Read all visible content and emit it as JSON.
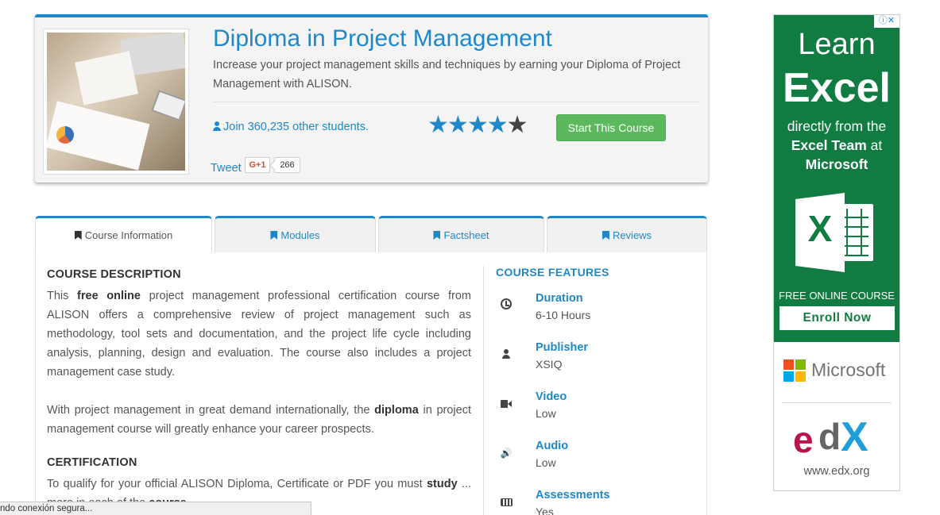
{
  "course": {
    "title": "Diploma in Project Management",
    "subtitle": "Increase your project management skills and techniques by earning your Diploma of Project Management with ALISON.",
    "join_text": "Join 360,235 other students.",
    "rating": 4,
    "rating_max": 5,
    "start_button": "Start This Course",
    "tweet_label": "Tweet",
    "gplus_label": "G+1",
    "gplus_count": "266"
  },
  "tabs": [
    {
      "label": "Course Information",
      "active": true
    },
    {
      "label": "Modules",
      "active": false
    },
    {
      "label": "Factsheet",
      "active": false
    },
    {
      "label": "Reviews",
      "active": false
    }
  ],
  "description": {
    "heading": "COURSE DESCRIPTION",
    "p1_before": "This ",
    "p1_bold1": "free online",
    "p1_after": " project management professional certification course from ALISON offers a comprehensive review of project management such as methodology, tool sets and documentation, and the project life cycle including analysis, planning, design and evaluation. The course also includes a project management case study.",
    "p2_before": "With project management in great demand internationally, the ",
    "p2_bold": "diploma",
    "p2_after": " in project management course will greatly enhance your career prospects.",
    "cert_heading": "CERTIFICATION",
    "p3_before": "To qualify for your official ALISON Diploma, Certificate or PDF you must ",
    "p3_bold1": "study",
    "p3_mid": " ... more in each of the ",
    "p3_bold2": "course"
  },
  "features": {
    "title": "COURSE FEATURES",
    "items": [
      {
        "label": "Duration",
        "value": "6-10 Hours",
        "icon": "clock-icon"
      },
      {
        "label": "Publisher",
        "value": "XSIQ",
        "icon": "user-icon"
      },
      {
        "label": "Video",
        "value": "Low",
        "icon": "video-camera-icon"
      },
      {
        "label": "Audio",
        "value": "Low",
        "icon": "speaker-icon"
      },
      {
        "label": "Assessments",
        "value": "Yes",
        "icon": "keyboard-icon"
      }
    ]
  },
  "ad": {
    "badge": "ⓘ✕",
    "learn": "Learn",
    "excel": "Excel",
    "line1": "directly from the",
    "line2_bold": "Excel Team",
    "line2_after": " at",
    "line3_bold": "Microsoft",
    "excel_logo_letter": "X",
    "free_course": "FREE ONLINE COURSE",
    "enroll": "Enroll Now",
    "microsoft": "Microsoft",
    "edx_url": "www.edx.org",
    "colors": {
      "green": "#107c41",
      "ms_red": "#f25022",
      "ms_green": "#7fba00",
      "ms_blue": "#00a4ef",
      "ms_yellow": "#ffb900"
    }
  },
  "status_bar": "ndo conexión segura...",
  "colors": {
    "accent": "#1e88c8",
    "button_green": "#5cb85c"
  }
}
